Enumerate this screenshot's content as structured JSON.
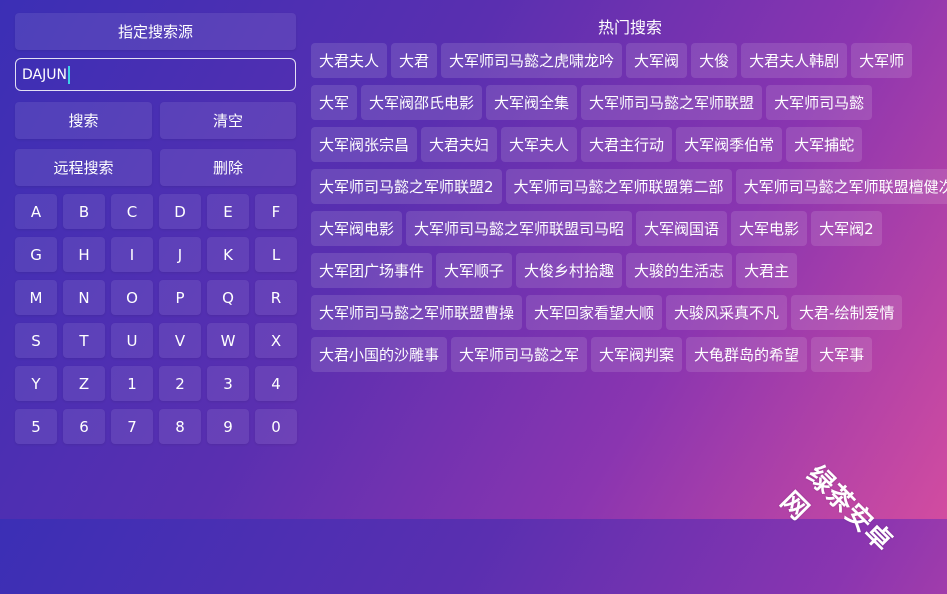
{
  "left": {
    "source_label": "指定搜索源",
    "input_value": "DAJUN",
    "search_label": "搜索",
    "clear_label": "清空",
    "remote_label": "远程搜索",
    "delete_label": "删除",
    "keys": [
      "A",
      "B",
      "C",
      "D",
      "E",
      "F",
      "G",
      "H",
      "I",
      "J",
      "K",
      "L",
      "M",
      "N",
      "O",
      "P",
      "Q",
      "R",
      "S",
      "T",
      "U",
      "V",
      "W",
      "X",
      "Y",
      "Z",
      "1",
      "2",
      "3",
      "4",
      "5",
      "6",
      "7",
      "8",
      "9",
      "0"
    ]
  },
  "hot": {
    "title": "热门搜索",
    "rows": [
      [
        "大君夫人",
        "大君",
        "大军师司马懿之虎啸龙吟",
        "大军阀",
        "大俊",
        "大君夫人韩剧",
        "大军师"
      ],
      [
        "大军",
        "大军阀邵氏电影",
        "大军阀全集",
        "大军师司马懿之军师联盟",
        "大军师司马懿"
      ],
      [
        "大军阀张宗昌",
        "大君夫妇",
        "大军夫人",
        "大君主行动",
        "大军阀季伯常",
        "大军捕蛇"
      ],
      [
        "大军师司马懿之军师联盟2",
        "大军师司马懿之军师联盟第二部",
        "大军师司马懿之军师联盟檀健次"
      ],
      [
        "大军阀电影",
        "大军师司马懿之军师联盟司马昭",
        "大军阀国语",
        "大军电影",
        "大军阀2"
      ],
      [
        "大军团广场事件",
        "大军顺子",
        "大俊乡村拾趣",
        "大骏的生活志",
        "大君主"
      ],
      [
        "大军师司马懿之军师联盟曹操",
        "大军回家看望大顺",
        "大骏风采真不凡",
        "大君-绘制爱情"
      ],
      [
        "大君小国的沙雕事",
        "大军师司马懿之军",
        "大军阀判案",
        "大龟群岛的希望",
        "大军事"
      ]
    ]
  },
  "watermark": "绿茶安卓网"
}
